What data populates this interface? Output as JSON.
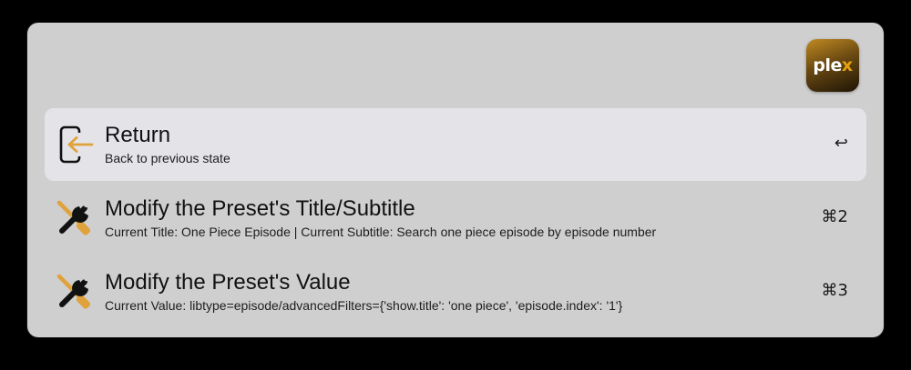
{
  "app": {
    "icon_name": "plex-icon",
    "icon_text_main": "ple",
    "icon_text_accent": "x",
    "accent_color": "#e5a00d"
  },
  "results": [
    {
      "title": "Return",
      "subtitle": "Back to previous state",
      "shortcut": "↩",
      "icon": "return-icon",
      "selected": true
    },
    {
      "title": "Modify the Preset's Title/Subtitle",
      "subtitle": "Current Title: One Piece Episode | Current Subtitle: Search one piece episode by episode number",
      "shortcut": "⌘2",
      "icon": "wrench-icon",
      "selected": false
    },
    {
      "title": "Modify the Preset's Value",
      "subtitle": "Current Value: libtype=episode/advancedFilters={'show.title': 'one piece', 'episode.index': '1'}",
      "shortcut": "⌘3",
      "icon": "wrench-icon",
      "selected": false
    }
  ]
}
